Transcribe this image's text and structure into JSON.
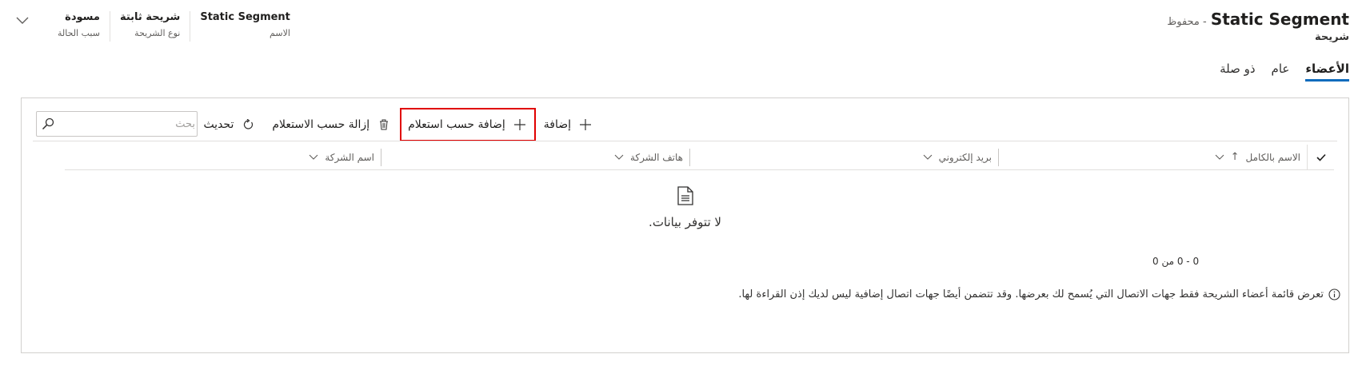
{
  "record": {
    "title": "Static Segment",
    "status_suffix": "- محفوظ",
    "entity": "شريحة"
  },
  "header_fields": [
    {
      "value": "مسودة",
      "label": "سبب الحالة"
    },
    {
      "value": "شريحة ثابتة",
      "label": "نوع الشريحة"
    },
    {
      "value": "Static Segment",
      "label": "الاسم"
    }
  ],
  "tabs": [
    {
      "label": "الأعضاء",
      "active": true
    },
    {
      "label": "عام",
      "active": false
    },
    {
      "label": "ذو صلة",
      "active": false
    }
  ],
  "commands": {
    "add": "إضافة",
    "add_by_query": "إضافة حسب استعلام",
    "remove_by_query": "إزالة حسب الاستعلام",
    "refresh": "تحديث"
  },
  "search": {
    "placeholder": "بحث",
    "value": ""
  },
  "grid": {
    "columns": [
      {
        "label": "الاسم بالكامل",
        "sort": "↑"
      },
      {
        "label": "بريد إلكتروني"
      },
      {
        "label": "هاتف الشركة"
      },
      {
        "label": "اسم الشركة"
      }
    ],
    "empty_text": "لا تتوفر بيانات.",
    "paging": "0 - 0 من 0"
  },
  "info_text": "تعرض قائمة أعضاء الشريحة فقط جهات الاتصال التي يُسمح لك بعرضها. وقد تتضمن أيضًا جهات اتصال إضافية ليس لديك إذن القراءة لها.",
  "colors": {
    "accent": "#0f6cbd",
    "highlight": "#e00000"
  }
}
